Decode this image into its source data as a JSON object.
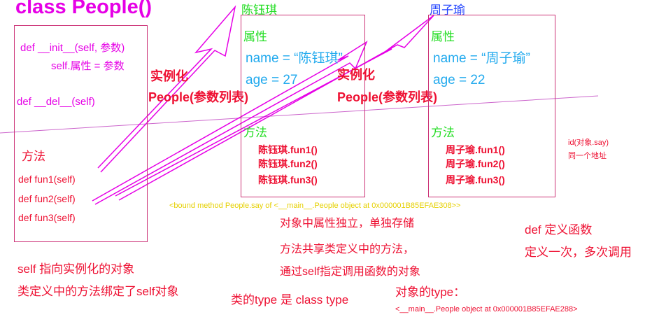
{
  "class_title": "class People()",
  "class_box": {
    "init_line": "def __init__(self,  参数)",
    "init_body": "self.属性 = 参数",
    "del_line": "def __del__(self)",
    "methods_label": "方法",
    "methods": [
      "def fun1(self)",
      "def fun2(self)",
      "def fun3(self)"
    ]
  },
  "instantiate": {
    "label": "实例化",
    "call": "People(参数列表)"
  },
  "objects": [
    {
      "name": "陈钰琪",
      "attr_label": "属性",
      "attr_name": "name = “陈钰琪”",
      "attr_age": "age  = 27",
      "methods_label": "方法",
      "methods": [
        "陈钰琪.fun1()",
        "陈钰琪.fun2()",
        "陈钰琪.fun3()"
      ]
    },
    {
      "name": "周子瑜",
      "attr_label": "属性",
      "attr_name": "name = “周子瑜”",
      "attr_age": "age  = 22",
      "methods_label": "方法",
      "methods": [
        "周子瑜.fun1()",
        "周子瑜.fun2()",
        "周子瑜.fun3()"
      ]
    }
  ],
  "id_note": [
    "id(对象.say)",
    "同一个地址"
  ],
  "bound_method": "<bound method People.say of <__main__.People object at 0x000001B85EFAE308>>",
  "notes_center": [
    "对象中属性独立，单独存储",
    "方法共享类定义中的方法，",
    "通过self指定调用函数的对象"
  ],
  "notes_left": [
    "self 指向实例化的对象",
    "类定义中的方法绑定了self对象"
  ],
  "notes_right": [
    "def 定义函数",
    "定义一次，多次调用"
  ],
  "type_class": "类的type 是 class type",
  "type_object_label": "对象的type：",
  "type_object_value": "<__main__.People object at 0x000001B85EFAE288>",
  "colors": {
    "magenta": "#e600e6",
    "red": "#ee1133",
    "green": "#22dd22",
    "cyan": "#22aaee",
    "blue": "#2244ff",
    "yellow": "#e6d000",
    "box_border": "#cc3377"
  }
}
